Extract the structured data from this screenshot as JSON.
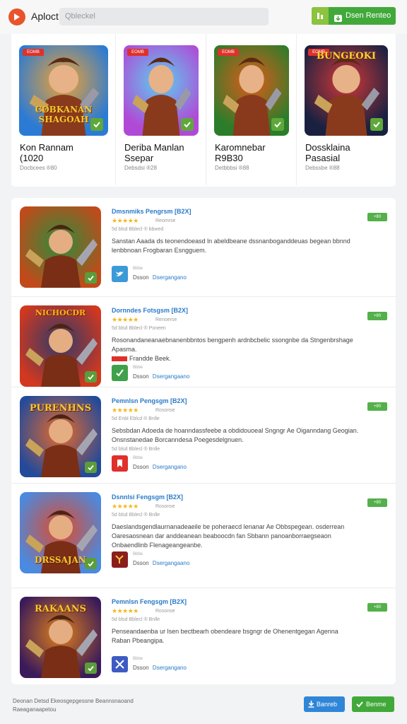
{
  "header": {
    "app_name": "Aploct",
    "search_placeholder": "Qbleckel",
    "action_label": "Dsen Renteo",
    "logo_icon": "play-logo-icon",
    "accent": "#41a93a"
  },
  "featured": [
    {
      "title": "Kon Rannam\n(1020",
      "sub": "Docbcees ®80",
      "badge": "EOMB",
      "art": "COBKANAN\nSHAGOAH",
      "colors": [
        "#2b7bd4",
        "#f2a230"
      ]
    },
    {
      "title": "Deriba Manlan\nSsepar",
      "sub": "Debsdsi ®28",
      "badge": "EOMB",
      "art": "",
      "colors": [
        "#b04ad6",
        "#5ad0f0"
      ]
    },
    {
      "title": "Karomnebar\nR9B30",
      "sub": "Detbbbsi ®88",
      "badge": "EOMB",
      "art": "",
      "colors": [
        "#2c7d2a",
        "#e05a1a"
      ]
    },
    {
      "title": "Dossklaina\nPasasial",
      "sub": "Debssbe ®88",
      "badge": "EOMB",
      "art": "BUNGEOKI",
      "colors": [
        "#1a2140",
        "#d23838"
      ]
    }
  ],
  "list": [
    {
      "title": "Dmsnmiks Pengrsm [B2X]",
      "stars": "★★★★★",
      "stars_note": "Reomrse",
      "meta": "5d blsd Bblecl ® bbwed",
      "desc": "Sanstan Aaada ds teonendoeasd ln abeldbeane dssnanboganddeuas begean bbnnd lenbbnoan Frogbaran Esngguem.",
      "red": false,
      "icon_bg": "#3b9ad8",
      "icon_name": "twitter-bird-icon",
      "icon_top": "Bbbe",
      "icon_label": "Dsson",
      "icon_link": "Dsergangano",
      "tag": "+80",
      "art": "",
      "colors": [
        "#c24a1a",
        "#2b8d3c"
      ]
    },
    {
      "title": "Dornndes Fotsgsm [B2X]",
      "stars": "★★★★★",
      "stars_note": "Renoerse",
      "meta": "5d blsd Bblecl ® Poneen",
      "desc": "Rosonandaneanaebnanenbbntos bengpenh ardnbcbelic ssongnbe da Stngenbrshage Apasma.",
      "desc2": "Frandde Beek.",
      "red": true,
      "icon_bg": "#3fa14a",
      "icon_name": "checkmark-icon",
      "icon_top": "Bbbe",
      "icon_label": "Dsson",
      "icon_link": "Dsergangaano",
      "tag": "+80",
      "art": "NICHOCDR",
      "colors": [
        "#d2381f",
        "#2c3a6a"
      ]
    },
    {
      "title": "Pemnlsn Pengsgm [B2X]",
      "stars": "★★★★★",
      "stars_note": "Rosonse",
      "meta": "5d Enbl Eblcd ® Bnlle",
      "desc": "Sebsbdan Adoeda de hoanndassfeebe a obdidouoeal Sngngr Ae Oiganndang Geogian.",
      "desc2": "Onsnstanedae Borcanndesa Poegesdelgnuen.",
      "meta2": "5d blsd Bblecl ® Bnlle",
      "red": false,
      "icon_bg": "#e0302a",
      "icon_name": "bookmark-icon",
      "icon_top": "Bbbe",
      "icon_label": "Dsson",
      "icon_link": "Dsergangano",
      "tag": "+80",
      "art": "PURENHNS",
      "colors": [
        "#244a9a",
        "#e86a28"
      ]
    },
    {
      "title": "Dsnnlsi Fengsgm [B2X]",
      "stars": "★★★★★",
      "stars_note": "Rosonse",
      "meta": "5d blsd Bblecl ® Bnlle",
      "desc": "Daeslandsgendlaurnanadeaeile be poheraecd lenanar Ae Obbspegean. osderrean",
      "desc2": "Oaresaosnean dar anddeanean beaboocdn fan Sbbann panoanborraegseaon",
      "desc3": "Onbaendlinb Flenageangeanbe.",
      "red": false,
      "icon_bg": "#8a1e1e",
      "icon_name": "puzzle-icon",
      "icon_top": "Bbbe",
      "icon_label": "Dsson",
      "icon_link": "Dsergangaano",
      "tag": "+80",
      "art": "DRSSAJAN",
      "colors": [
        "#4a8ae0",
        "#e04a2a"
      ]
    },
    {
      "title": "Pemnlsn Fengsgm [B2X]",
      "stars": "★★★★★",
      "stars_note": "Rosonse",
      "meta": "5d blsd Bblecl ® Bnlle",
      "desc": "Penseandaenba ur lsen bectbearh obendeare bsgngr de Ohenentgegan Agenna",
      "desc2": "Raban  Pbeangipa.",
      "red": false,
      "icon_bg": "#3e5bc4",
      "icon_name": "crossed-swords-icon",
      "icon_top": "Bbbe",
      "icon_label": "Dsson",
      "icon_link": "Dsergangano",
      "tag": "+80",
      "art": "RAKAANS",
      "colors": [
        "#3a1a5a",
        "#e0801a"
      ]
    }
  ],
  "footer": {
    "line1": "Deonan  Detsd  Ekeosgepgessne  Beannsnaoand",
    "line2": "Raeaganaapetou",
    "blue_label": "Banreb",
    "green_label": "Benme"
  }
}
